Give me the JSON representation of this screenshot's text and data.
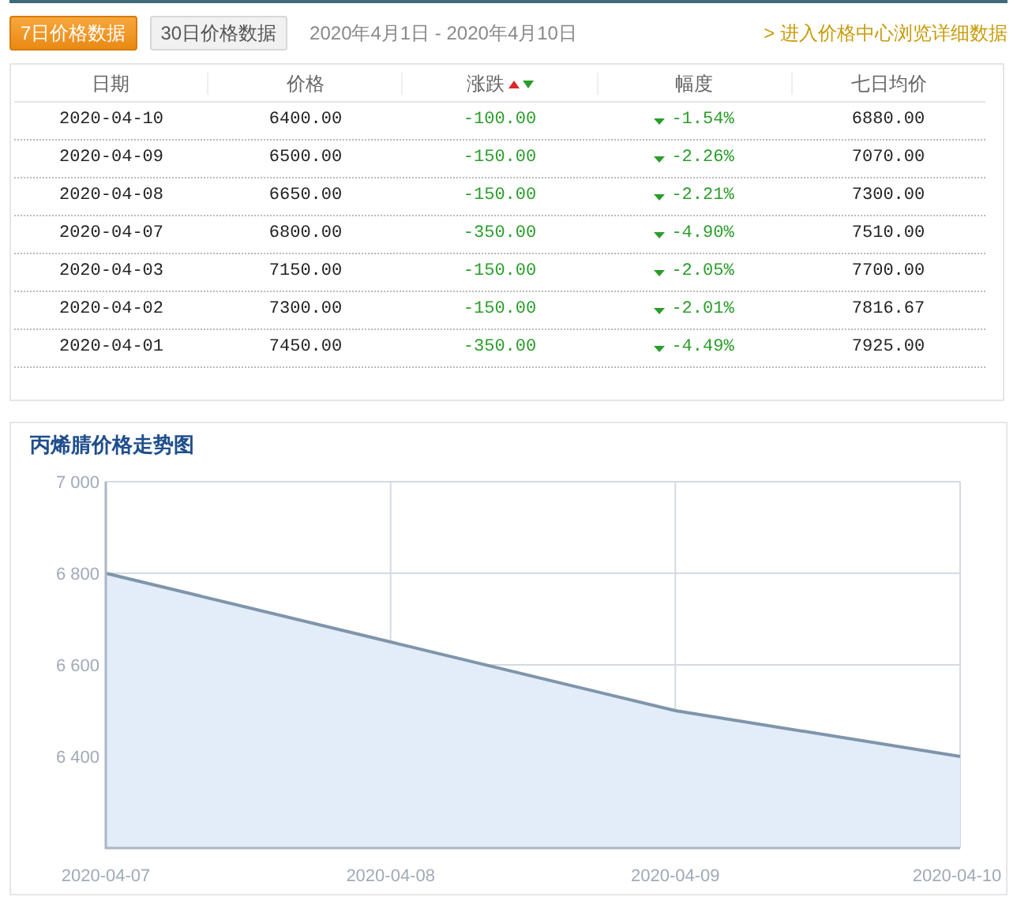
{
  "tabs": [
    {
      "label": "7日价格数据",
      "selected": true
    },
    {
      "label": "30日价格数据",
      "selected": false
    }
  ],
  "date_range": "2020年4月1日 - 2020年4月10日",
  "detail_link": {
    "arrow": ">",
    "label": "进入价格中心浏览详细数据"
  },
  "table": {
    "columns": [
      "日期",
      "价格",
      "涨跌",
      "幅度",
      "七日均价"
    ],
    "rows": [
      {
        "date": "2020-04-10",
        "price": "6400.00",
        "change": "-100.00",
        "pct": "-1.54%",
        "avg": "6880.00"
      },
      {
        "date": "2020-04-09",
        "price": "6500.00",
        "change": "-150.00",
        "pct": "-2.26%",
        "avg": "7070.00"
      },
      {
        "date": "2020-04-08",
        "price": "6650.00",
        "change": "-150.00",
        "pct": "-2.21%",
        "avg": "7300.00"
      },
      {
        "date": "2020-04-07",
        "price": "6800.00",
        "change": "-350.00",
        "pct": "-4.90%",
        "avg": "7510.00"
      },
      {
        "date": "2020-04-03",
        "price": "7150.00",
        "change": "-150.00",
        "pct": "-2.05%",
        "avg": "7700.00"
      },
      {
        "date": "2020-04-02",
        "price": "7300.00",
        "change": "-150.00",
        "pct": "-2.01%",
        "avg": "7816.67"
      },
      {
        "date": "2020-04-01",
        "price": "7450.00",
        "change": "-350.00",
        "pct": "-4.49%",
        "avg": "7925.00"
      }
    ]
  },
  "chart": {
    "title": "丙烯腈价格走势图",
    "chart_data": {
      "type": "area",
      "categories": [
        "2020-04-07",
        "2020-04-08",
        "2020-04-09",
        "2020-04-10"
      ],
      "series": [
        {
          "color": "#7f95ab",
          "values": [
            6800,
            6650,
            6500,
            6400
          ]
        }
      ],
      "grid": true,
      "ylim": [
        6200,
        7000
      ],
      "yticks": [
        {
          "value": 6400,
          "label": "6 400"
        },
        {
          "value": 6600,
          "label": "6 600"
        },
        {
          "value": 6800,
          "label": "6 800"
        },
        {
          "value": 7000,
          "label": "7 000"
        }
      ]
    }
  }
}
